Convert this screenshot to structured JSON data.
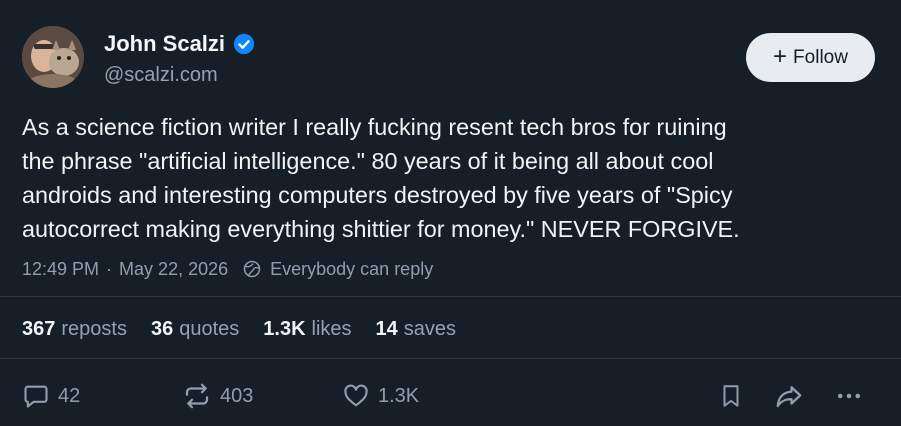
{
  "author": {
    "display_name": "John Scalzi",
    "handle": "@scalzi.com",
    "verified": true,
    "avatar_icon": "avatar-photo"
  },
  "follow_button": {
    "label": "Follow",
    "icon": "plus-icon"
  },
  "post": {
    "text": "As a science fiction writer I really fucking resent tech bros for ruining\nthe phrase \"artificial intelligence.\" 80 years of it being all about cool\nandroids and interesting computers destroyed by five years of \"Spicy\nautocorrect making everything shittier for money.\" NEVER FORGIVE.",
    "time": "12:49 PM",
    "separator": "·",
    "date": "May 22, 2026",
    "reply_setting": "Everybody can reply"
  },
  "stats": {
    "reposts": {
      "count": "367",
      "label": "reposts"
    },
    "quotes": {
      "count": "36",
      "label": "quotes"
    },
    "likes": {
      "count": "1.3K",
      "label": "likes"
    },
    "saves": {
      "count": "14",
      "label": "saves"
    }
  },
  "actions": {
    "reply_count": "42",
    "repost_count": "403",
    "like_count": "1.3K"
  },
  "colors": {
    "background": "#161e27",
    "verified_blue": "#1185fe",
    "muted_text": "#8f9fb0",
    "follow_button_bg": "#e8ebef"
  }
}
